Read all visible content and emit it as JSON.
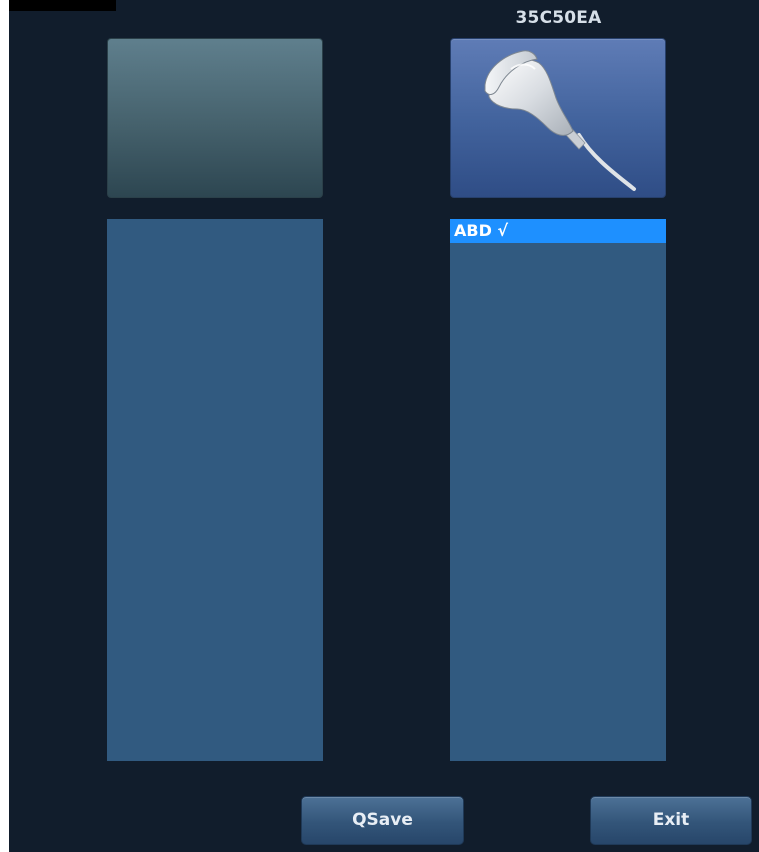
{
  "probe": {
    "name": "35C50EA"
  },
  "slots": {
    "left": {
      "state": "empty"
    },
    "right": {
      "state": "active",
      "icon": "convex-probe-icon"
    }
  },
  "exam_lists": {
    "left": {
      "items": []
    },
    "right": {
      "items": [
        {
          "label": "ABD √",
          "selected": true
        }
      ]
    }
  },
  "buttons": {
    "qsave_label": "QSave",
    "exit_label": "Exit"
  },
  "colors": {
    "background": "#111d2c",
    "list_bg": "#315a80",
    "selection": "#1e90ff"
  }
}
